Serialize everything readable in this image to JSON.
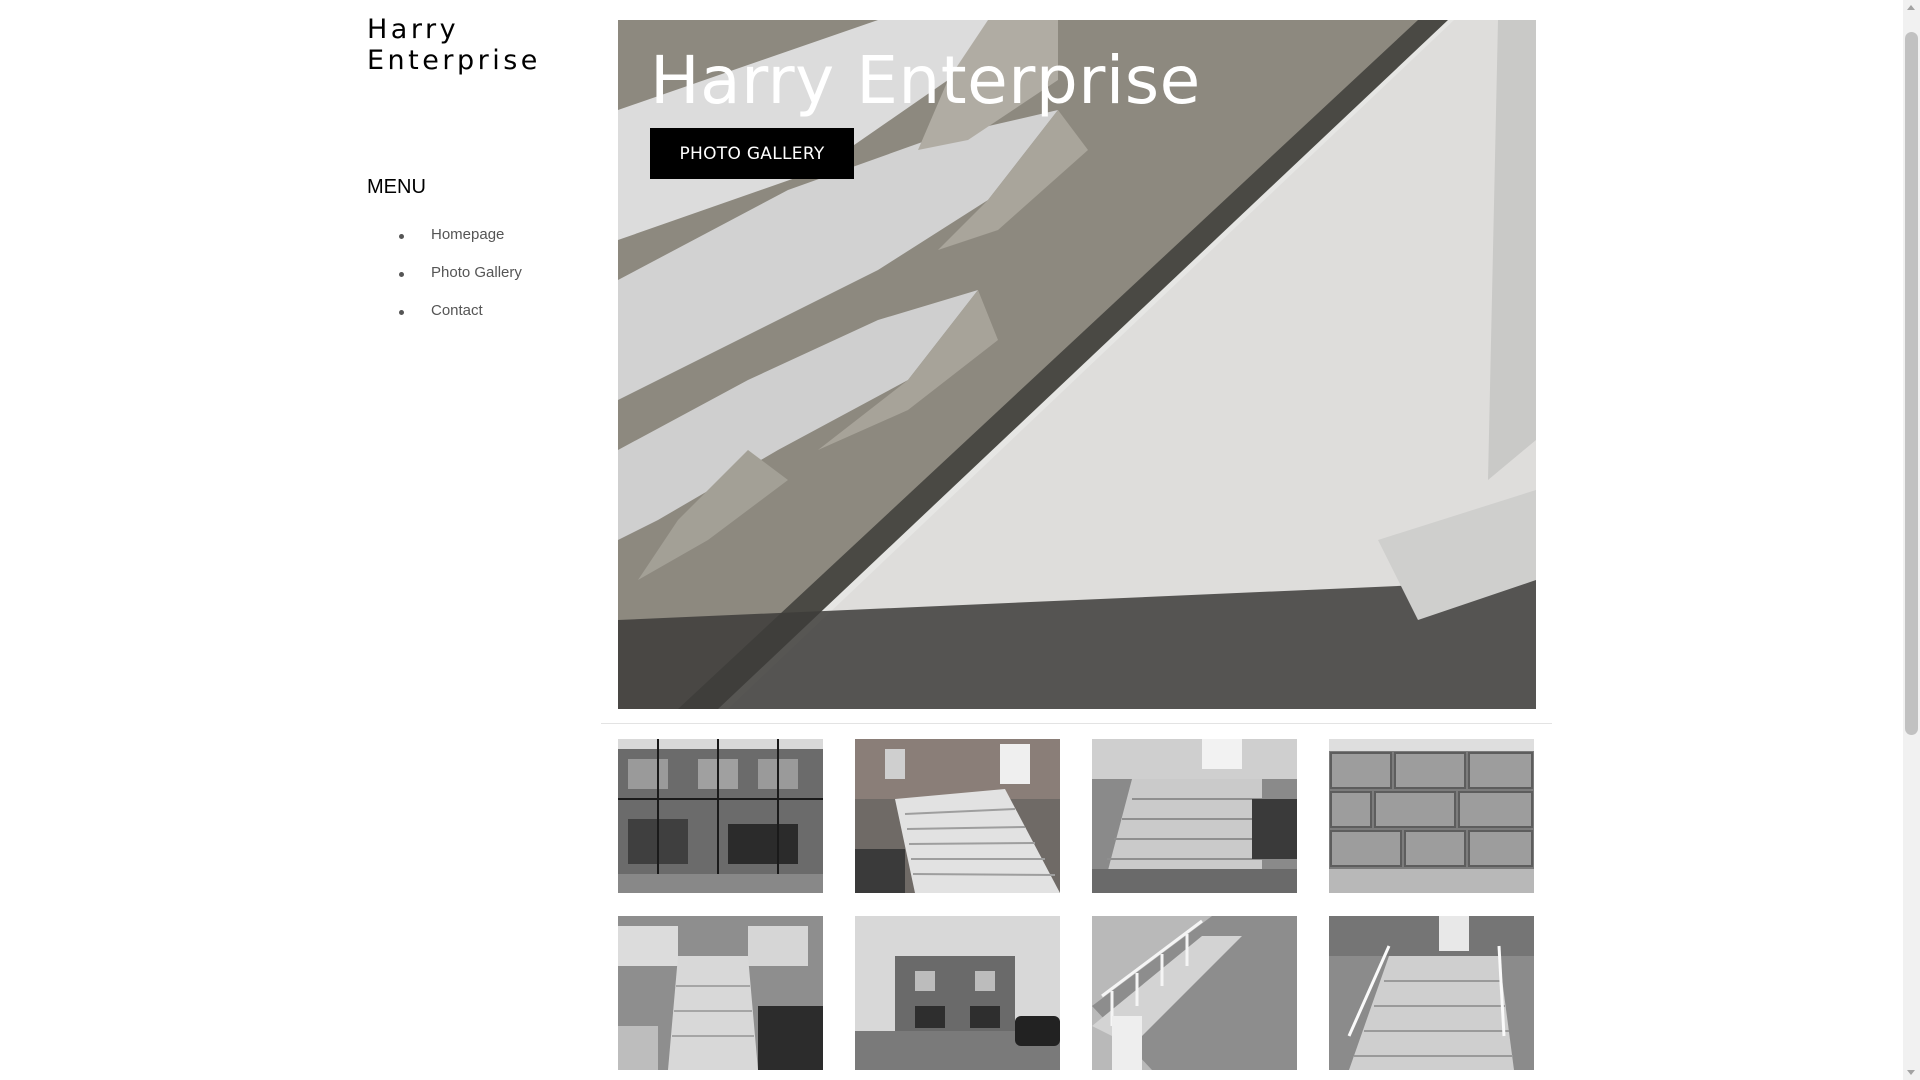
{
  "site": {
    "brand_line1": "Harry",
    "brand_line2": "Enterprise"
  },
  "menu": {
    "title": "MENU",
    "items": [
      {
        "label": "Homepage"
      },
      {
        "label": "Photo Gallery"
      },
      {
        "label": "Contact"
      }
    ]
  },
  "hero": {
    "title": "Harry Enterprise",
    "button_label": "PHOTO GALLERY"
  },
  "gallery": {
    "thumbnails": [
      {
        "subject": "building-scaffolding"
      },
      {
        "subject": "concrete-stairs"
      },
      {
        "subject": "entry-steps"
      },
      {
        "subject": "stone-wall"
      },
      {
        "subject": "front-stoop-railings"
      },
      {
        "subject": "brick-house"
      },
      {
        "subject": "stairs-white-railing"
      },
      {
        "subject": "porch-steps-railing"
      }
    ]
  },
  "colors": {
    "button_bg": "#000000",
    "button_text": "#ffffff",
    "menu_text": "#555555"
  }
}
